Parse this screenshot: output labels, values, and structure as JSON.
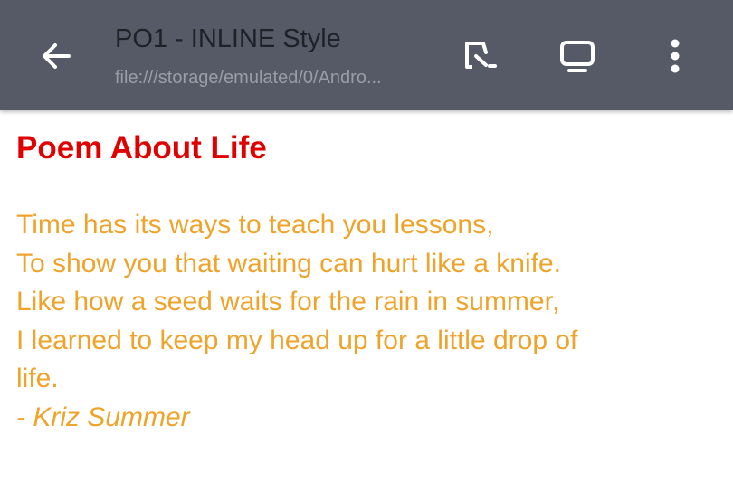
{
  "toolbar": {
    "title": "PO1 - INLINE Style",
    "url": "file:///storage/emulated/0/Andro...",
    "icons": {
      "back": "arrow-left-icon",
      "open_external": "open-in-app-icon",
      "desktop": "monitor-icon",
      "menu": "more-vert-icon"
    },
    "colors": {
      "background": "#565a66",
      "icon": "#ffffff"
    }
  },
  "page": {
    "heading": "Poem About Life",
    "heading_color": "#e00000",
    "text_color": "#f0a32a",
    "lines": [
      "Time has its ways to teach you lessons,",
      "To show you that waiting can hurt like a knife.",
      "Like how a seed waits for the rain in summer,",
      "I learned to keep my head up for a little drop of",
      "life."
    ],
    "author": "- Kriz Summer"
  }
}
